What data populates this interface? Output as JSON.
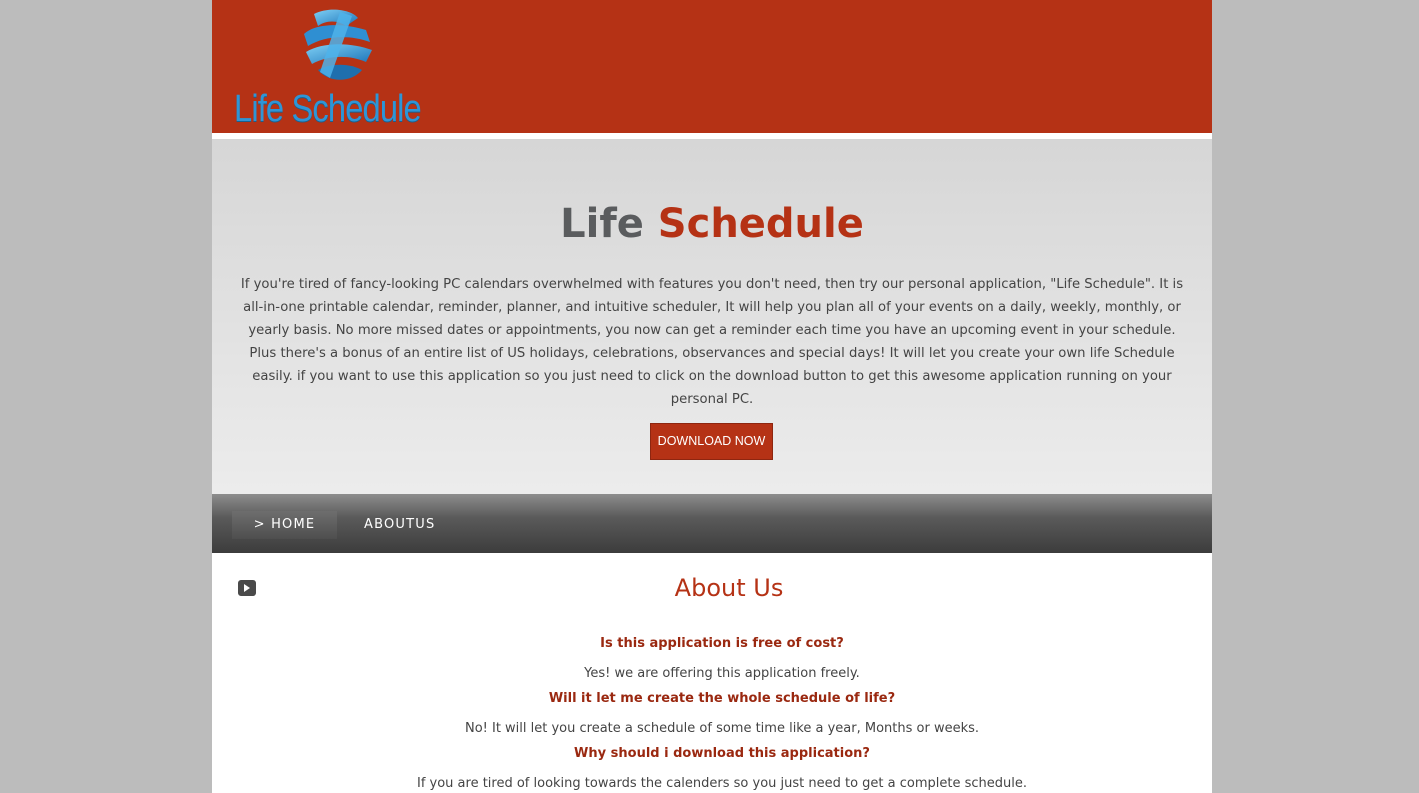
{
  "header": {
    "logo_text": "Life Schedule"
  },
  "hero": {
    "title_part1": "Life",
    "title_part2": "Schedule",
    "description": "If you're tired of fancy-looking PC calendars overwhelmed with features you don't need, then try our personal application, \"Life Schedule\". It is all-in-one printable calendar, reminder, planner, and intuitive scheduler, It will help you plan all of your events on a daily, weekly, monthly, or yearly basis. No more missed dates or appointments, you now can get a reminder each time you have an upcoming event in your schedule. Plus there's a bonus of an entire list of US holidays, celebrations, observances and special days! It will let you create your own life Schedule easily. if you want to use this application so you just need to click on the download button to get this awesome application running on your personal PC.",
    "download_label": "DOWNLOAD NOW"
  },
  "nav": {
    "home_label": "> HOME",
    "about_label": "ABOUTUS"
  },
  "about": {
    "title": "About Us",
    "faq": [
      {
        "q": "Is this application is free of cost?",
        "a": "Yes! we are offering this application freely."
      },
      {
        "q": "Will it let me create the whole schedule of life?",
        "a": "No! It will let you create a schedule of some time like a year, Months or weeks."
      },
      {
        "q": "Why should i download this application?",
        "a": "If you are tired of looking towards the calenders so you just need to get a complete schedule."
      }
    ]
  },
  "colors": {
    "brand_red": "#b53215",
    "logo_blue": "#2e95d6",
    "page_background": "#bcbcbc"
  }
}
